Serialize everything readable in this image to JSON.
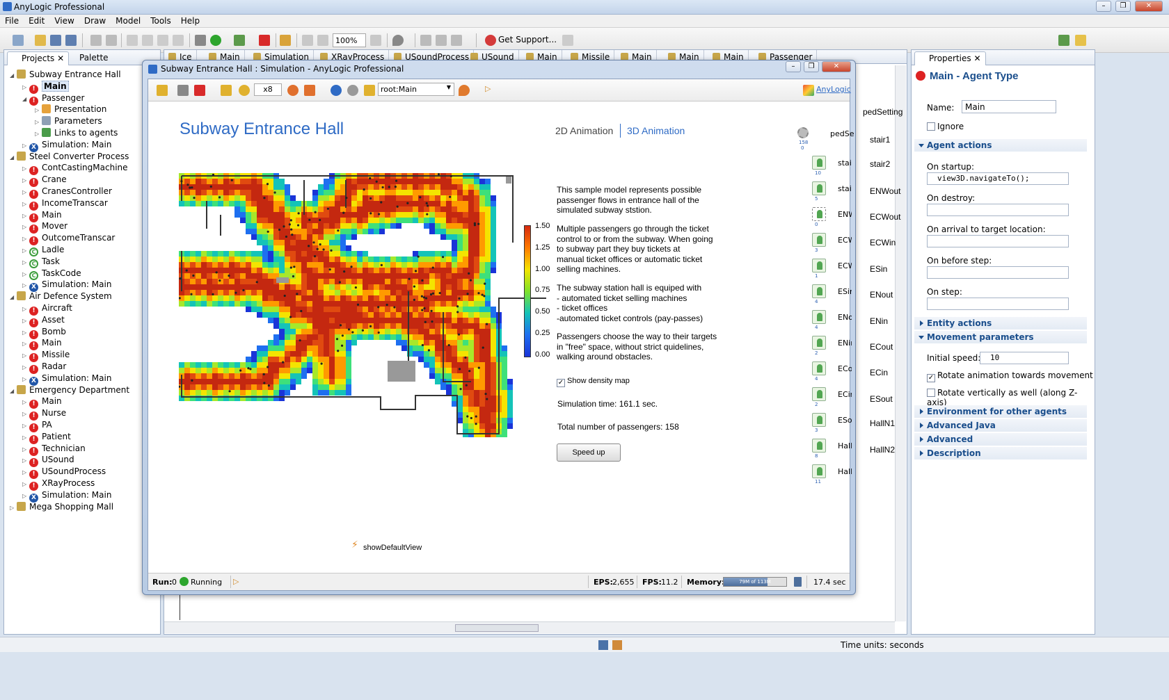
{
  "app": {
    "title": "AnyLogic Professional"
  },
  "menu": [
    "File",
    "Edit",
    "View",
    "Draw",
    "Model",
    "Tools",
    "Help"
  ],
  "toolbar": {
    "zoom": "100%",
    "get_support": "Get Support..."
  },
  "projects_panel": {
    "tabs": [
      "Projects",
      "Palette"
    ],
    "tree": [
      {
        "label": "Subway Entrance Hall",
        "icon": "project-icon",
        "level": 0,
        "expanded": true
      },
      {
        "label": "Main",
        "icon": "agent-type-icon",
        "level": 1,
        "selected": true
      },
      {
        "label": "Passenger",
        "icon": "agent-type-icon",
        "level": 1,
        "expanded": true
      },
      {
        "label": "Presentation",
        "icon": "presentation-icon",
        "level": 2
      },
      {
        "label": "Parameters",
        "icon": "parameters-icon",
        "level": 2
      },
      {
        "label": "Links to agents",
        "icon": "links-icon",
        "level": 2
      },
      {
        "label": "Simulation: Main",
        "icon": "experiment-icon",
        "level": 1
      },
      {
        "label": "Steel Converter Process",
        "icon": "project-icon",
        "level": 0,
        "expanded": true
      },
      {
        "label": "ContCastingMachine",
        "icon": "agent-type-icon",
        "level": 1
      },
      {
        "label": "Crane",
        "icon": "agent-type-icon",
        "level": 1
      },
      {
        "label": "CranesController",
        "icon": "agent-type-icon",
        "level": 1
      },
      {
        "label": "IncomeTranscar",
        "icon": "agent-type-icon",
        "level": 1
      },
      {
        "label": "Main",
        "icon": "agent-type-icon",
        "level": 1
      },
      {
        "label": "Mover",
        "icon": "agent-type-icon",
        "level": 1
      },
      {
        "label": "OutcomeTranscar",
        "icon": "agent-type-icon",
        "level": 1
      },
      {
        "label": "Ladle",
        "icon": "java-class-icon",
        "level": 1
      },
      {
        "label": "Task",
        "icon": "java-class-icon",
        "level": 1
      },
      {
        "label": "TaskCode",
        "icon": "java-class-icon",
        "level": 1
      },
      {
        "label": "Simulation: Main",
        "icon": "experiment-icon",
        "level": 1
      },
      {
        "label": "Air Defence System",
        "icon": "project-icon",
        "level": 0,
        "expanded": true
      },
      {
        "label": "Aircraft",
        "icon": "agent-type-icon",
        "level": 1
      },
      {
        "label": "Asset",
        "icon": "agent-type-icon",
        "level": 1
      },
      {
        "label": "Bomb",
        "icon": "agent-type-icon",
        "level": 1
      },
      {
        "label": "Main",
        "icon": "agent-type-icon",
        "level": 1
      },
      {
        "label": "Missile",
        "icon": "agent-type-icon",
        "level": 1
      },
      {
        "label": "Radar",
        "icon": "agent-type-icon",
        "level": 1
      },
      {
        "label": "Simulation: Main",
        "icon": "experiment-icon",
        "level": 1
      },
      {
        "label": "Emergency Department",
        "icon": "project-icon",
        "level": 0,
        "expanded": true
      },
      {
        "label": "Main",
        "icon": "agent-type-icon",
        "level": 1
      },
      {
        "label": "Nurse",
        "icon": "agent-type-icon",
        "level": 1
      },
      {
        "label": "PA",
        "icon": "agent-type-icon",
        "level": 1
      },
      {
        "label": "Patient",
        "icon": "agent-type-icon",
        "level": 1
      },
      {
        "label": "Technician",
        "icon": "agent-type-icon",
        "level": 1
      },
      {
        "label": "USound",
        "icon": "agent-type-icon",
        "level": 1
      },
      {
        "label": "USoundProcess",
        "icon": "agent-type-icon",
        "level": 1
      },
      {
        "label": "XRayProcess",
        "icon": "agent-type-icon",
        "level": 1
      },
      {
        "label": "Simulation: Main",
        "icon": "experiment-icon",
        "level": 1
      },
      {
        "label": "Mega Shopping Mall",
        "icon": "project-icon",
        "level": 0,
        "expanded": false
      }
    ]
  },
  "editor_tabs": [
    "Ice",
    "Main",
    "Simulation",
    "XRayProcess",
    "USoundProcess",
    "USound",
    "Main",
    "Missile",
    "Main",
    "Main",
    "Main",
    "Passenger"
  ],
  "editor_right_labels": [
    "pedSetting",
    "stair1",
    "stair2",
    "ENWout",
    "ECWout",
    "ECWin",
    "ESin",
    "ENout",
    "ENin",
    "ECout",
    "ECin",
    "ESout",
    "HallN1",
    "HallN2"
  ],
  "sim_window": {
    "title": "Subway Entrance Hall : Simulation - AnyLogic Professional",
    "speed": "x8",
    "root": "root:Main",
    "anylogic_link": "AnyLogic",
    "model_title": "Subway Entrance Hall",
    "view_2d": "2D Animation",
    "view_3d": "3D Animation",
    "ped_settings_label": "pedSe",
    "ped_count": "158",
    "ped_count2": "0",
    "agents": [
      {
        "label": "stai",
        "num": "10"
      },
      {
        "label": "stai",
        "num": "5"
      },
      {
        "label": "ENW",
        "num": "0"
      },
      {
        "label": "ECW",
        "num": "3"
      },
      {
        "label": "ECW",
        "num": "1"
      },
      {
        "label": "ESin",
        "num": "4"
      },
      {
        "label": "ENo",
        "num": "4"
      },
      {
        "label": "ENir",
        "num": "2"
      },
      {
        "label": "ECo",
        "num": "4"
      },
      {
        "label": "ECin",
        "num": "2"
      },
      {
        "label": "ESo",
        "num": "3"
      },
      {
        "label": "Hall",
        "num": "8"
      },
      {
        "label": "Hall",
        "num": "11"
      }
    ],
    "legend_ticks": [
      "1.50",
      "1.25",
      "1.00",
      "0.75",
      "0.50",
      "0.25",
      "0.00"
    ],
    "description1": "This sample model represents possible\npassenger flows in entrance hall of the\nsimulated subway ststion.",
    "description2": "Multiple passengers go through the ticket\ncontrol to or from the subway. When going\nto subway part they buy tickets at\nmanual ticket offices or automatic ticket\nselling machines.",
    "description3": "The subway station hall is equiped with\n- automated ticket selling machines\n- ticket offices\n-automated ticket controls (pay-passes)",
    "description4": "Passengers choose the way to their targets\nin \"free\" space, without strict quidelines,\nwalking around obstacles.",
    "show_density_map": "Show density map",
    "simulation_time": "Simulation time: 161.1 sec.",
    "total_passengers": "Total number of passengers: 158",
    "speed_up": "Speed up",
    "show_default_view": "showDefaultView",
    "status": {
      "run_label": "Run:",
      "run_value": "0",
      "running": "Running",
      "eps_label": "EPS:",
      "eps_value": "2,655",
      "fps_label": "FPS:",
      "fps_value": "11.2",
      "memory_label": "Memory:",
      "memory_value": "79M of 113M",
      "memory_fraction": 0.7,
      "time": "17.4 sec"
    }
  },
  "properties": {
    "tab": "Properties",
    "title": "Main - Agent Type",
    "name_label": "Name:",
    "name_value": "Main",
    "ignore_label": "Ignore",
    "agent_actions": "Agent actions",
    "on_startup": "On startup:",
    "on_startup_value": "view3D.navigateTo();",
    "on_destroy": "On destroy:",
    "on_arrival": "On arrival to target location:",
    "on_before_step": "On before step:",
    "on_step": "On step:",
    "entity_actions": "Entity actions",
    "movement_parameters": "Movement parameters",
    "initial_speed_label": "Initial speed:",
    "initial_speed_value": "10",
    "rotate_anim": "Rotate animation towards movement",
    "rotate_vert": "Rotate vertically as well (along Z-axis)",
    "env_other": "Environment for other agents",
    "advanced_java": "Advanced Java",
    "advanced": "Advanced",
    "description": "Description"
  },
  "status_bar": {
    "time_units": "Time units: seconds"
  },
  "colors": {
    "accent": "#2f6bc5",
    "agent_red": "#d22222",
    "experiment_blue": "#2156a8"
  }
}
